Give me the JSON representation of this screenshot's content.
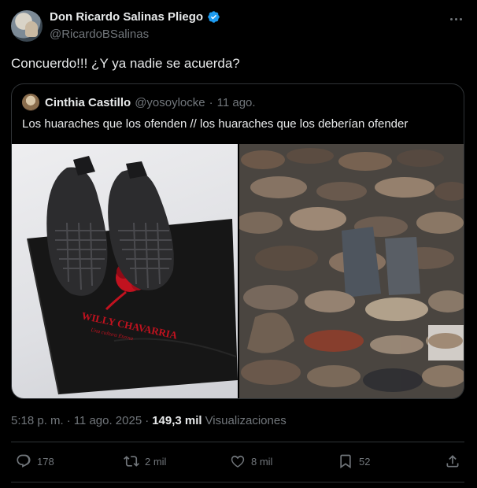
{
  "author": {
    "name": "Don Ricardo Salinas Pliego",
    "handle": "@RicardoBSalinas",
    "verified_icon": "verified-badge-icon"
  },
  "tweet": {
    "text": "Concuerdo!!! ¿Y ya nadie se acuerda?"
  },
  "quote": {
    "name": "Cinthia Castillo",
    "handle": "@yosoylocke",
    "separator": "·",
    "time": "11 ago.",
    "text": "Los huaraches que los ofenden // los huaraches que los deberían ofender",
    "left_image": {
      "bag_brand": "WILLY CHAVARRIA",
      "bag_tagline": "Una cultura Eterna"
    }
  },
  "meta": {
    "time": "5:18 p. m.",
    "dot1": "·",
    "date": "11 ago. 2025",
    "dot2": "·",
    "views_count": "149,3 mil",
    "views_label": "Visualizaciones"
  },
  "actions": {
    "replies": "178",
    "reposts": "2 mil",
    "likes": "8 mil",
    "bookmarks": "52"
  },
  "colors": {
    "background": "#000000",
    "text": "#e7e9ea",
    "secondary": "#71767b",
    "border": "#2f3336",
    "verified": "#1d9bf0"
  }
}
